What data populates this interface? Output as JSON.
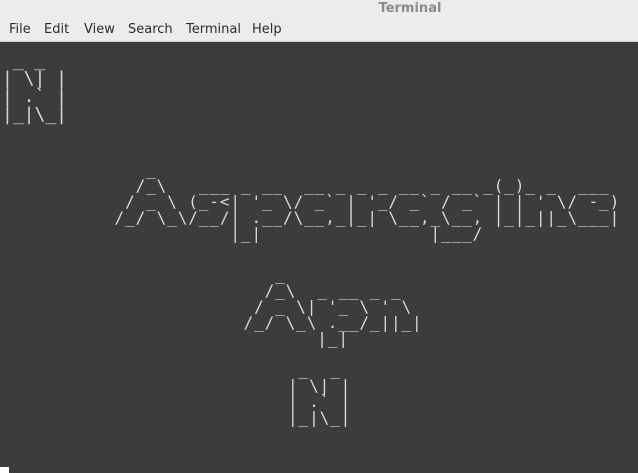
{
  "window": {
    "title": "Terminal"
  },
  "menu": {
    "file": "File",
    "edit": "Edit",
    "view": "View",
    "search": "Search",
    "terminal": "Terminal",
    "help": "Help"
  },
  "terminal": {
    "lines": {
      "n_top": " _ _\n| \\| |\n| .` |\n|_|\\_|",
      "asparagine": "    _\n   /_\\   ___ _ __  __ _ _ _ __ _ __ _(_)_ _  ___\n  / _ \\ (_-<| '_ \\/ _` | '_/ _` / _` | | ' \\/ -_)\n /_/ \\_\\/__/| .__/\\__,_|_| \\__,_\\__, |_|_||_\\___|\n            |_|                |___/",
      "apn": "    _\n   /_\\  _ __ _ _\n  / _ \\| '_ \\ ' \\\n /_/ \\_\\ .__/_||_|\n        |_|",
      "n_bottom": " _  _\n| \\| |\n| .` |\n|_|\\_|"
    }
  },
  "colors": {
    "terminal_bg": "#3c3c3c",
    "terminal_fg": "#d8d8d8",
    "chrome_bg": "#ececec",
    "title_fg": "#8a8a8a"
  }
}
